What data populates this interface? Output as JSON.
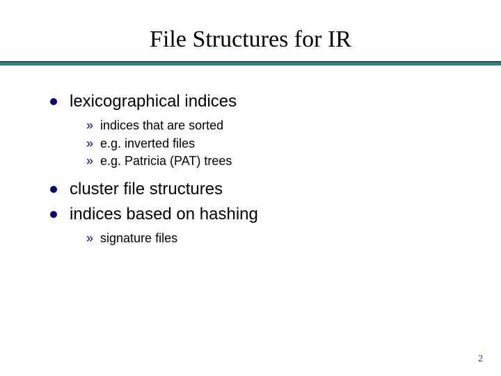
{
  "slide": {
    "title": "File Structures for IR",
    "page_number": "2"
  },
  "colors": {
    "rule": "#2b8080",
    "bullet": "#000080",
    "pagenum": "#4a2ea0"
  },
  "content": {
    "items": [
      {
        "text": "lexicographical indices",
        "sub": [
          "indices that are sorted",
          "e.g. inverted files",
          "e.g. Patricia (PAT) trees"
        ]
      },
      {
        "text": "cluster file structures",
        "sub": []
      },
      {
        "text": "indices based on hashing",
        "sub": [
          "signature files"
        ]
      }
    ]
  }
}
